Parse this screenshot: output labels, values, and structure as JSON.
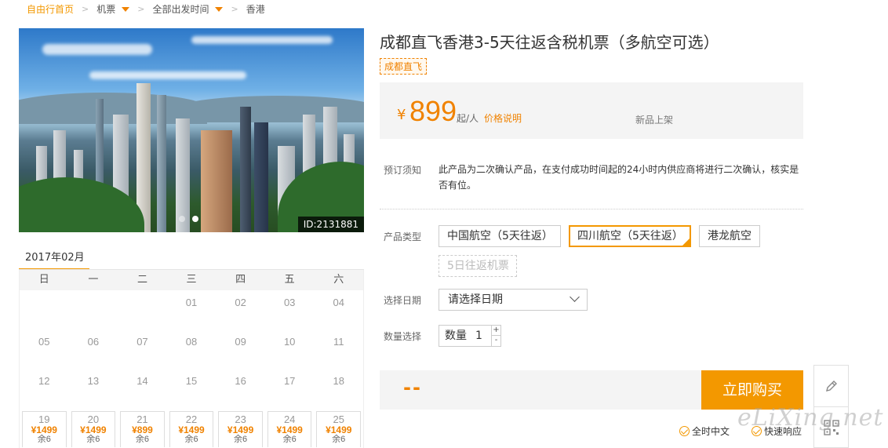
{
  "breadcrumb": {
    "home": "自由行首页",
    "flight": "机票",
    "departure": "全部出发时间",
    "destination": "香港"
  },
  "hero": {
    "image_id": "ID:2131881",
    "slide_index": 2,
    "slide_count": 2
  },
  "calendar": {
    "month": "2017年02月",
    "weekdays": [
      "日",
      "一",
      "二",
      "三",
      "四",
      "五",
      "六"
    ],
    "rows": [
      [
        "",
        "",
        "",
        "01",
        "02",
        "03",
        "04"
      ],
      [
        "05",
        "06",
        "07",
        "08",
        "09",
        "10",
        "11"
      ],
      [
        "12",
        "13",
        "14",
        "15",
        "16",
        "17",
        "18"
      ]
    ],
    "priced_days": [
      {
        "day": "19",
        "price": "¥1499",
        "remain": "余6"
      },
      {
        "day": "20",
        "price": "¥1499",
        "remain": "余6"
      },
      {
        "day": "21",
        "price": "¥899",
        "remain": "余6"
      },
      {
        "day": "22",
        "price": "¥1499",
        "remain": "余6"
      },
      {
        "day": "23",
        "price": "¥1499",
        "remain": "余6"
      },
      {
        "day": "24",
        "price": "¥1499",
        "remain": "余6"
      },
      {
        "day": "25",
        "price": "¥1499",
        "remain": "余6"
      }
    ]
  },
  "product": {
    "title": "成都直飞香港3-5天往返含税机票（多航空可选）",
    "tag": "成都直飞",
    "currency": "¥",
    "price": "899",
    "price_unit": "起/人",
    "price_note": "价格说明",
    "new_label": "新品上架"
  },
  "booking": {
    "notice_label": "预订须知",
    "notice_text": "此产品为二次确认产品，在支付成功时间起的24小时内供应商将进行二次确认，核实是否有位。",
    "type_label": "产品类型",
    "types": [
      {
        "label": "中国航空（5天往返）",
        "state": "normal"
      },
      {
        "label": "四川航空（5天往返）",
        "state": "selected"
      },
      {
        "label": "港龙航空",
        "state": "normal"
      },
      {
        "label": "5日往返机票",
        "state": "disabled"
      }
    ],
    "date_label": "选择日期",
    "date_placeholder": "请选择日期",
    "qty_label": "数量选择",
    "qty_text": "数量",
    "qty_value": "1",
    "plus": "+",
    "minus": "-",
    "total": "--",
    "buy_label": "立即购买"
  },
  "guarantees": [
    "全时中文",
    "快速响应"
  ],
  "side_tools": [
    "edit-icon",
    "qr-code-icon"
  ],
  "watermark": "eLiXing.net",
  "colors": {
    "accent": "#f39800",
    "price": "#f08200"
  }
}
